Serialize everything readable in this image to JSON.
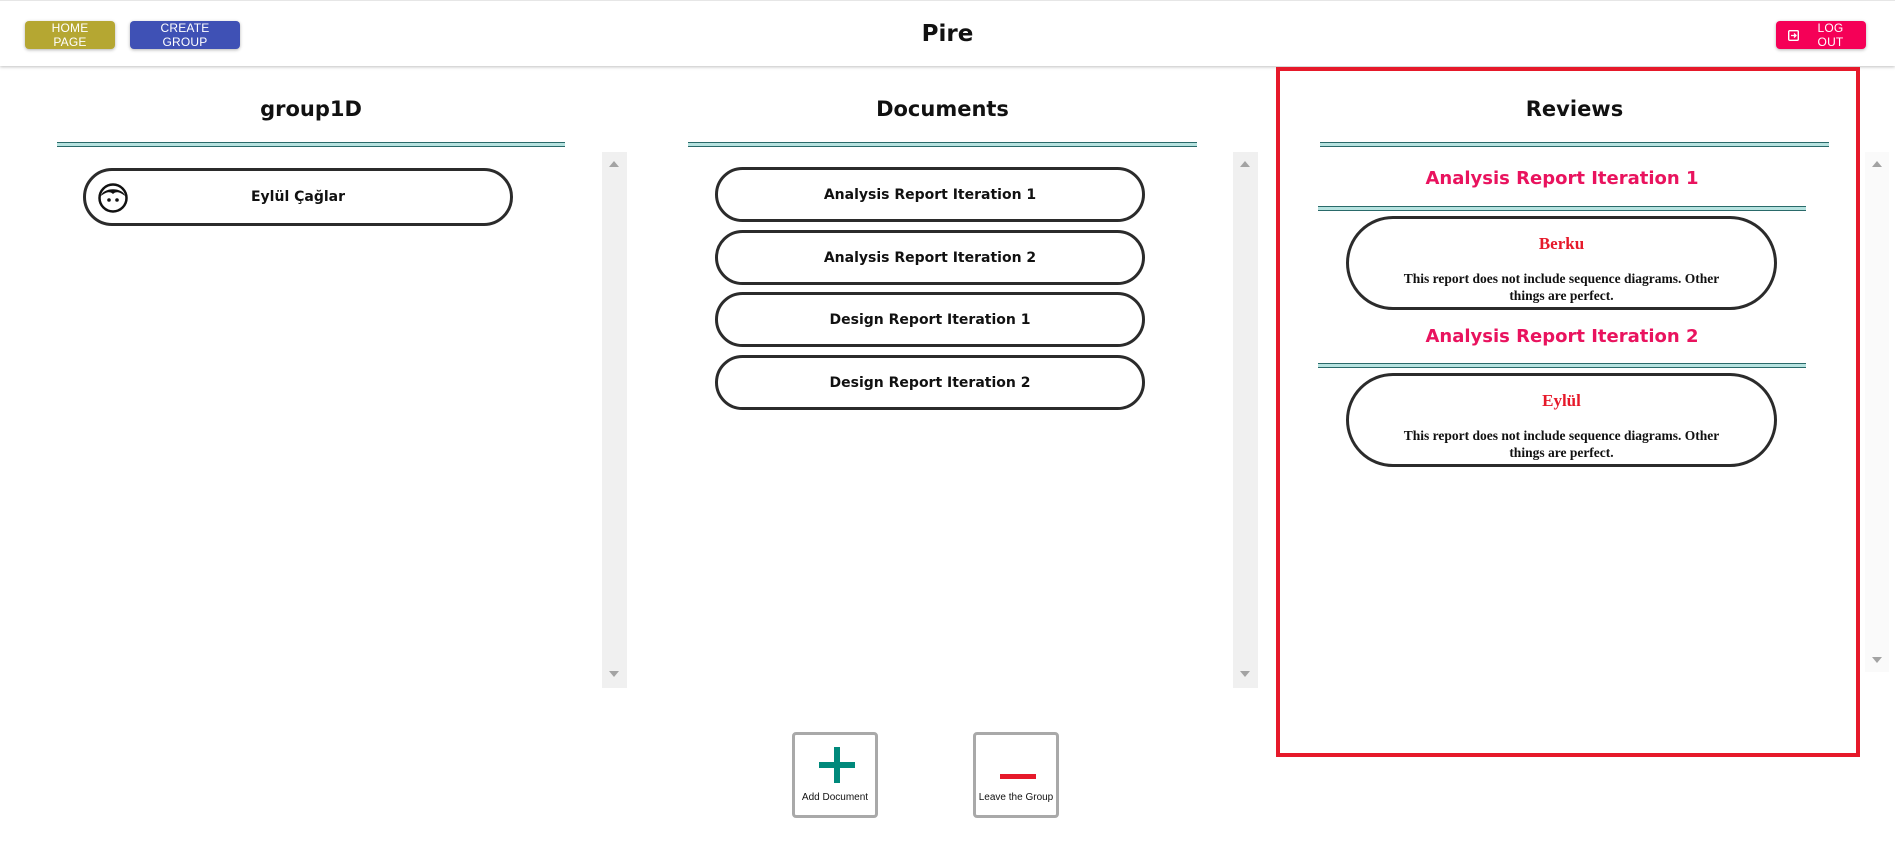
{
  "header": {
    "home_label": "HOME PAGE",
    "create_group_label": "CREATE GROUP",
    "title": "Pire",
    "logout_label": "LOG OUT"
  },
  "group": {
    "title": "group1D",
    "members": [
      {
        "name": "Eylül Çağlar",
        "icon": "person-face-icon"
      }
    ]
  },
  "documents": {
    "title": "Documents",
    "items": [
      "Analysis Report Iteration 1",
      "Analysis Report Iteration 2",
      "Design Report Iteration 1",
      "Design Report Iteration 2"
    ]
  },
  "reviews": {
    "title": "Reviews",
    "sections": [
      {
        "document": "Analysis Report Iteration 1",
        "reviewer": "Berku",
        "text": "This report does not include sequence diagrams. Other things are perfect."
      },
      {
        "document": "Analysis Report Iteration 2",
        "reviewer": "Eylül",
        "text": "This report does not include sequence diagrams. Other things are perfect."
      }
    ]
  },
  "actions": {
    "add_document_label": "Add Document",
    "leave_group_label": "Leave the Group"
  },
  "colors": {
    "home": "#b5a732",
    "create": "#3f51b5",
    "logout": "#f50057",
    "highlight_border": "#e6192a",
    "review_heading": "#e9135e",
    "add_icon": "#00897b",
    "leave_icon": "#e6192a"
  }
}
